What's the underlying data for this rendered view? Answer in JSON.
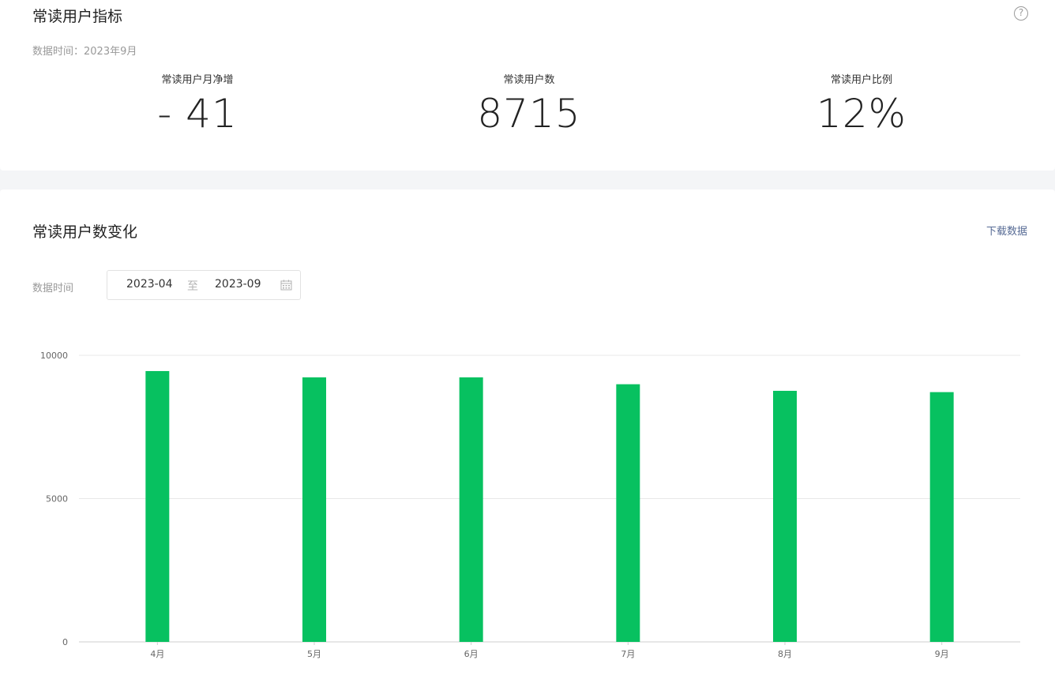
{
  "indicators": {
    "title": "常读用户指标",
    "data_time": "数据时间：2023年9月",
    "metrics": [
      {
        "label": "常读用户月净增",
        "value": "- 41"
      },
      {
        "label": "常读用户数",
        "value": "8715"
      },
      {
        "label": "常读用户比例",
        "value": "12%"
      }
    ]
  },
  "change": {
    "title": "常读用户数变化",
    "download_label": "下载数据",
    "filter_label": "数据时间",
    "date_start": "2023-04",
    "date_sep": "至",
    "date_end": "2023-09"
  },
  "colors": {
    "bar": "#07c160"
  },
  "icons": {
    "help": "question-circle-icon",
    "calendar": "calendar-icon"
  },
  "chart_data": {
    "type": "bar",
    "categories": [
      "4月",
      "5月",
      "6月",
      "7月",
      "8月",
      "9月"
    ],
    "values": [
      9450,
      9230,
      9230,
      8990,
      8760,
      8715
    ],
    "ylim": [
      0,
      10000
    ],
    "yticks": [
      0,
      5000,
      10000
    ],
    "grid": true
  }
}
